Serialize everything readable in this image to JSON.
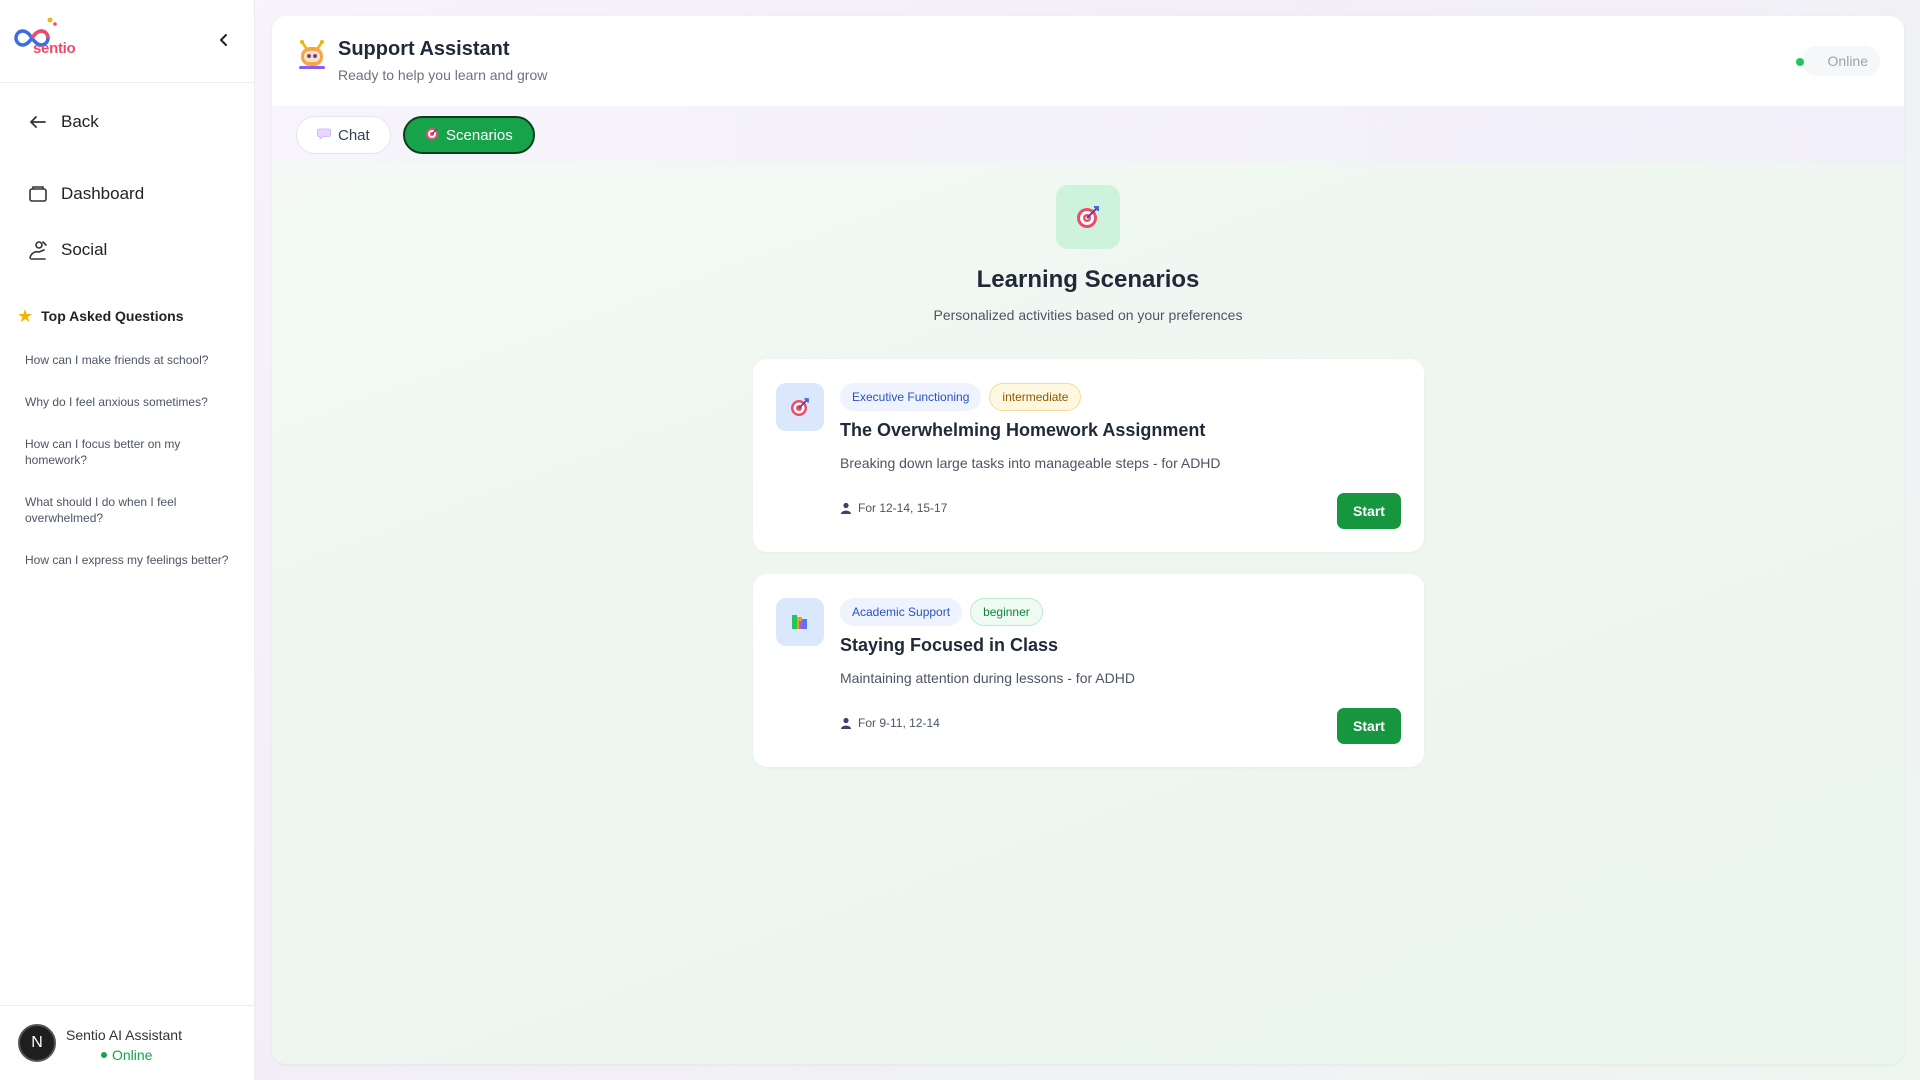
{
  "app": {
    "logo_text": "sentio"
  },
  "sidebar": {
    "back_label": "Back",
    "nav": [
      {
        "label": "Dashboard",
        "icon": "dashboard-icon"
      },
      {
        "label": "Social",
        "icon": "social-icon"
      }
    ],
    "top_questions_title": "Top Asked Questions",
    "questions": [
      "How can I make friends at school?",
      "Why do I feel anxious sometimes?",
      "How can I focus better on my homework?",
      "What should I do when I feel overwhelmed?",
      "How can I express my feelings better?"
    ],
    "footer": {
      "avatar_initial": "N",
      "name": "Sentio AI Assistant",
      "status": "Online"
    }
  },
  "header": {
    "title": "Support Assistant",
    "subtitle": "Ready to help you learn and grow",
    "status": "Online"
  },
  "tabs": [
    {
      "label": "Chat",
      "icon": "speech-bubble-icon",
      "active": false
    },
    {
      "label": "Scenarios",
      "icon": "target-icon",
      "active": true
    }
  ],
  "hero": {
    "title": "Learning Scenarios",
    "subtitle": "Personalized activities based on your preferences"
  },
  "scenarios": [
    {
      "category": "Executive Functioning",
      "level": "intermediate",
      "title": "The Overwhelming Homework Assignment",
      "description": "Breaking down large tasks into manageable steps - for ADHD",
      "ages": "For 12-14, 15-17",
      "button": "Start",
      "icon": "target-icon"
    },
    {
      "category": "Academic Support",
      "level": "beginner",
      "title": "Staying Focused in Class",
      "description": "Maintaining attention during lessons - for ADHD",
      "ages": "For 9-11, 12-14",
      "button": "Start",
      "icon": "books-icon"
    }
  ],
  "colors": {
    "accent": "#16a34a",
    "online": "#22c55e",
    "brand": "#ef4a6b"
  }
}
